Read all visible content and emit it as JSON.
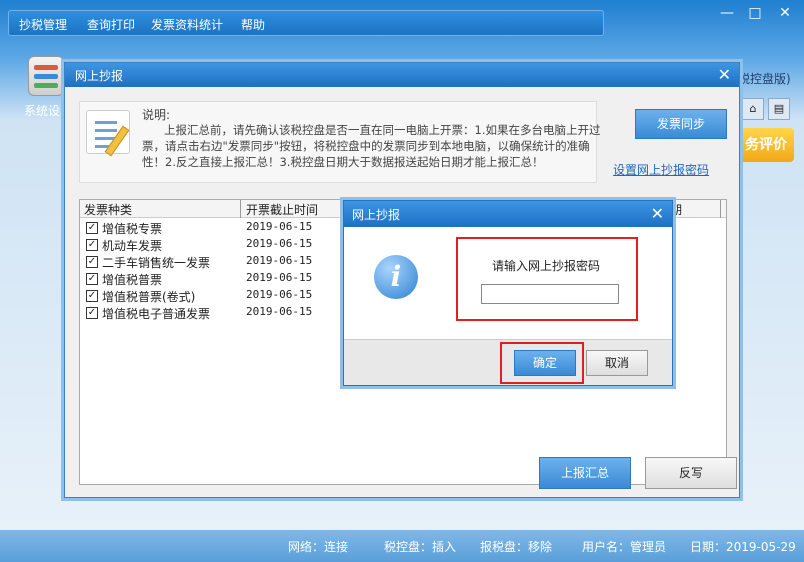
{
  "menu": {
    "items": [
      "抄税管理",
      "查询打印",
      "发票资料统计",
      "帮助"
    ]
  },
  "window_controls": {
    "minimize": "—",
    "maximize": "□",
    "close": "✕"
  },
  "toolbar": {
    "system_label": "系统设"
  },
  "right_panel": {
    "title_fragment": "税控盘版)",
    "eval_badge": "务评价"
  },
  "main_dialog": {
    "title": "网上抄报",
    "notice": {
      "heading": "说明:",
      "body": "上报汇总前，请先确认该税控盘是否一直在同一电脑上开票：1.如果在多台电脑上开过票，请点击右边\"发票同步\"按钮，将税控盘中的发票同步到本地电脑，以确保统计的准确性！2.反之直接上报汇总！3.税控盘日期大于数据报送起始日期才能上报汇总！"
    },
    "sync_button": "发票同步",
    "password_link": "设置网上抄报密码",
    "grid": {
      "columns": [
        "发票种类",
        "开票截止时间",
        "",
        "期"
      ],
      "rows": [
        {
          "checked": true,
          "name": "增值税专票",
          "date": "2019-06-15"
        },
        {
          "checked": true,
          "name": "机动车发票",
          "date": "2019-06-15"
        },
        {
          "checked": true,
          "name": "二手车销售统一发票",
          "date": "2019-06-15"
        },
        {
          "checked": true,
          "name": "增值税普票",
          "date": "2019-06-15"
        },
        {
          "checked": true,
          "name": "增值税普票(卷式)",
          "date": "2019-06-15"
        },
        {
          "checked": true,
          "name": "增值税电子普通发票",
          "date": "2019-06-15"
        }
      ]
    },
    "submit_button": "上报汇总",
    "reverse_button": "反写"
  },
  "password_dialog": {
    "title": "网上抄报",
    "prompt": "请输入网上抄报密码",
    "password_value": "",
    "ok_button": "确定",
    "cancel_button": "取消",
    "highlight_color": "#e02020"
  },
  "status_bar": {
    "network": "网络：连接",
    "tax_disk": "税控盘：插入",
    "report_disk": "报税盘：移除",
    "user": "用户名：管理员",
    "date": "日期：2019-05-29"
  },
  "colors": {
    "accent": "#1d70c4",
    "badge": "#f2a818"
  }
}
